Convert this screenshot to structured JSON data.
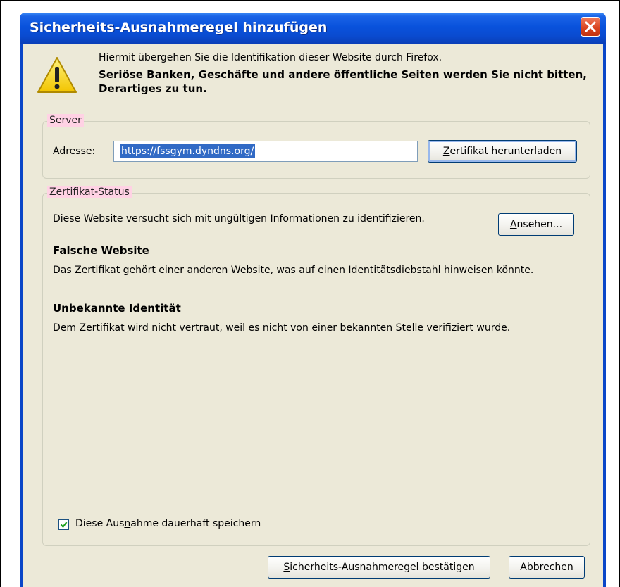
{
  "window": {
    "title": "Sicherheits-Ausnahmeregel hinzufügen"
  },
  "intro": {
    "line1": "Hiermit übergehen Sie die Identifikation dieser Website durch Firefox.",
    "line2": "Seriöse Banken, Geschäfte und andere öffentliche Seiten werden Sie nicht bitten, Derartiges zu tun."
  },
  "server": {
    "legend": "Server",
    "address_label": "Adresse:",
    "address_value": "https://fssgym.dyndns.org/",
    "download_button": {
      "pre": "",
      "accel": "Z",
      "post": "ertifikat herunterladen"
    }
  },
  "status": {
    "legend": "Zertifikat-Status",
    "summary": "Diese Website versucht sich mit ungültigen Informationen zu identifizieren.",
    "view_button": {
      "pre": "",
      "accel": "A",
      "post": "nsehen..."
    },
    "wrong_site_heading": "Falsche Website",
    "wrong_site_text": "Das Zertifikat gehört einer anderen Website, was auf einen Identitätsdiebstahl hinweisen könnte.",
    "unknown_identity_heading": "Unbekannte Identität",
    "unknown_identity_text": "Dem Zertifikat wird nicht vertraut, weil es nicht von einer bekannten Stelle verifiziert wurde.",
    "permanent_checkbox": {
      "pre": "Diese Aus",
      "accel": "n",
      "post": "ahme dauerhaft speichern",
      "checked": true
    }
  },
  "footer": {
    "confirm_button": {
      "pre": "",
      "accel": "S",
      "post": "icherheits-Ausnahmeregel bestätigen"
    },
    "cancel_button": "Abbrechen"
  },
  "icons": {
    "warning": "warning-triangle-icon",
    "close": "close-icon",
    "checkmark": "checkmark-icon"
  },
  "colors": {
    "titlebar": "#0a52dc",
    "dialog_background": "#ece9d8",
    "selection": "#316ac5",
    "legend_highlight": "#ffd2e4",
    "close_button": "#d8421e"
  }
}
